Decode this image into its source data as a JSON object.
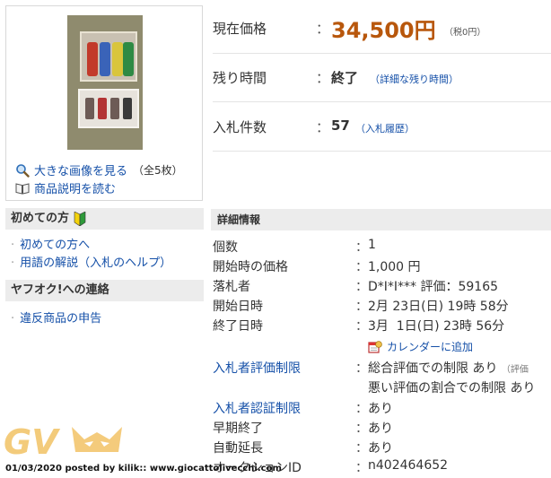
{
  "image_links": {
    "enlarge": "大きな画像を見る",
    "count": "（全5枚）",
    "description": "商品説明を読む"
  },
  "sidebar": {
    "beginners_heading": "初めての方",
    "beginners_items": [
      "初めての方へ",
      "用語の解説（入札のヘルプ）"
    ],
    "contact_heading": "ヤフオク!への連絡",
    "contact_items": [
      "違反商品の申告"
    ]
  },
  "summary": {
    "price_label": "現在価格",
    "price_value": "34,500円",
    "tax_note": "（税0円）",
    "time_label": "残り時間",
    "time_value": "終了",
    "time_link": "（詳細な残り時間）",
    "bids_label": "入札件数",
    "bids_value": "57",
    "bids_link": "（入札履歴）",
    "colon": "："
  },
  "details": {
    "heading": "詳細情報",
    "rows": [
      {
        "label": "個数",
        "value": "1"
      },
      {
        "label": "開始時の価格",
        "value": "1,000 円"
      },
      {
        "label": "落札者",
        "value": "D*I*I*** 評価：59165"
      },
      {
        "label": "開始日時",
        "value": "2月 23日(日) 19時 58分"
      },
      {
        "label": "終了日時",
        "value": "3月  1日(日) 23時 56分"
      },
      {
        "label": "入札者評価制限",
        "value": "総合評価での制限 あり",
        "note": "（評価"
      },
      {
        "label": "",
        "value": "悪い評価の割合での制限 あり"
      },
      {
        "label": "入札者認証制限",
        "value": "あり"
      },
      {
        "label": "早期終了",
        "value": "あり"
      },
      {
        "label": "自動延長",
        "value": "あり"
      },
      {
        "label": "オークションID",
        "value": "n402464652"
      }
    ],
    "calendar_link": "カレンダーに追加"
  },
  "watermark": {
    "logo_text": "GV",
    "footer": "01/03/2020 posted by kilik:: www.giocattolivecchi.com"
  },
  "colors": {
    "price": "#b8570c",
    "link": "#1550a8",
    "header_bg": "#ececec",
    "logo": "#f2c265"
  }
}
